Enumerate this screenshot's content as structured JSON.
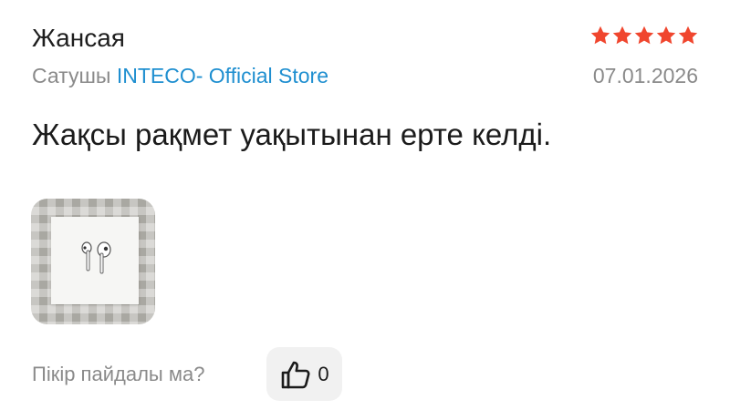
{
  "review": {
    "author": "Жансая",
    "rating": 5,
    "seller_prefix": "Сатушы",
    "seller_name": "INTECO- Official Store",
    "date": "07.01.2026",
    "text": "Жақсы рақмет уақытынан ерте келді.",
    "photos": [
      {
        "icon": "earbuds-photo"
      }
    ]
  },
  "helpful": {
    "question": "Пікір пайдалы ма?",
    "like_count": "0",
    "icon": "thumbs-up-icon"
  },
  "colors": {
    "star": "#f0462e",
    "seller_link": "#1f8fd0",
    "muted_text": "#8a8a8a",
    "like_bg": "#f1f1f1"
  }
}
